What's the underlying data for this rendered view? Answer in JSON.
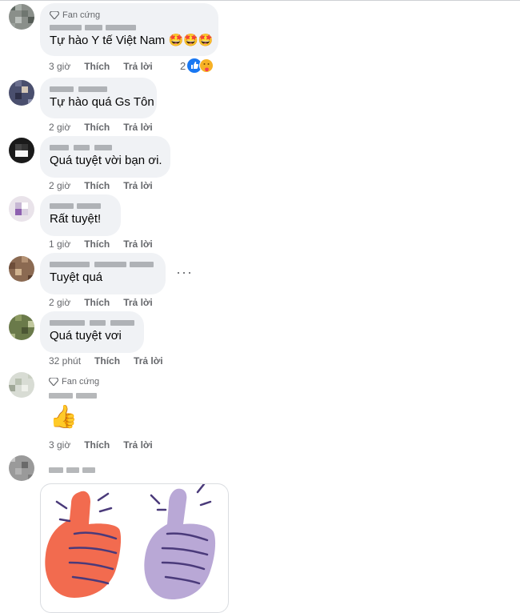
{
  "comments": [
    {
      "badge": "Fan cứng",
      "text": "Tự hào Y tế Việt Nam",
      "emoji": "🤩🤩🤩",
      "time": "3 giờ",
      "like": "Thích",
      "reply": "Trả lời",
      "reaction_count": "2"
    },
    {
      "text": "Tự hào quá Gs Tôn",
      "time": "2 giờ",
      "like": "Thích",
      "reply": "Trả lời"
    },
    {
      "text": "Quá tuyệt vời bạn ơi.",
      "time": "2 giờ",
      "like": "Thích",
      "reply": "Trả lời"
    },
    {
      "text": "Rất tuyệt!",
      "time": "1 giờ",
      "like": "Thích",
      "reply": "Trả lời"
    },
    {
      "text": "Tuyệt quá",
      "time": "2 giờ",
      "like": "Thích",
      "reply": "Trả lời",
      "more": "···"
    },
    {
      "text": "Quá tuyệt vơi",
      "time": "32 phút",
      "like": "Thích",
      "reply": "Trả lời"
    },
    {
      "badge": "Fan cứng",
      "emoji": "👍",
      "time": "3 giờ",
      "like": "Thích",
      "reply": "Trả lời"
    },
    {
      "sticker": "thumbs-up-sticker"
    }
  ],
  "colors": {
    "bubble": "#f0f2f5",
    "meta": "#65676b",
    "like_blue": "#1877f2",
    "sticker_orange": "#f26b4f",
    "sticker_purple": "#b9a8d6",
    "sticker_line": "#4a3a7a"
  }
}
